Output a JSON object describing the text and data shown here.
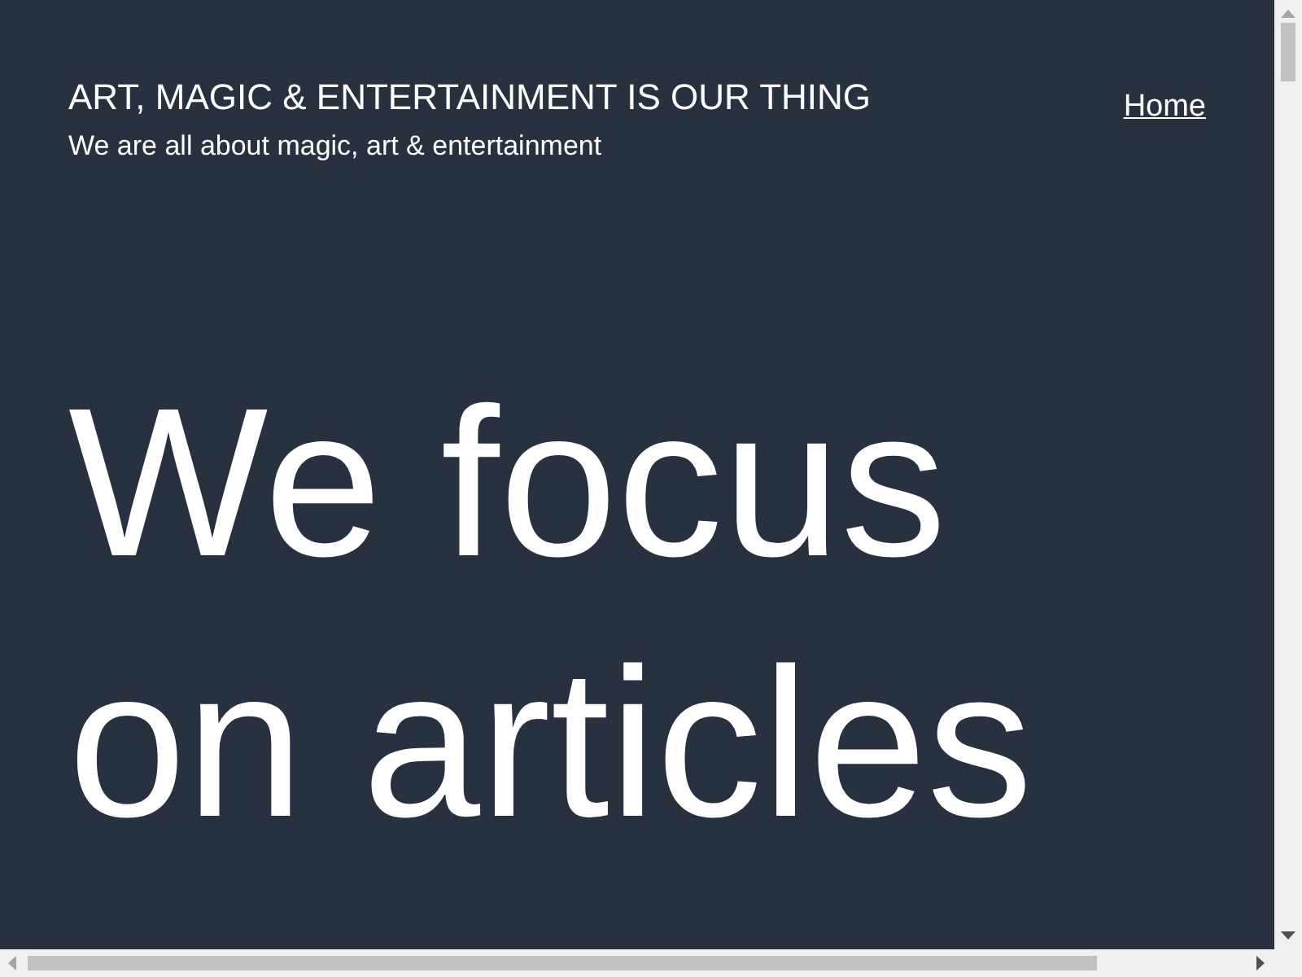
{
  "header": {
    "site_title": "ART, MAGIC & ENTERTAINMENT IS OUR THING",
    "tagline": "We are all about magic, art & entertainment"
  },
  "nav": {
    "links": [
      "Home"
    ]
  },
  "hero": {
    "lines": [
      "We focus",
      "on articles"
    ]
  }
}
